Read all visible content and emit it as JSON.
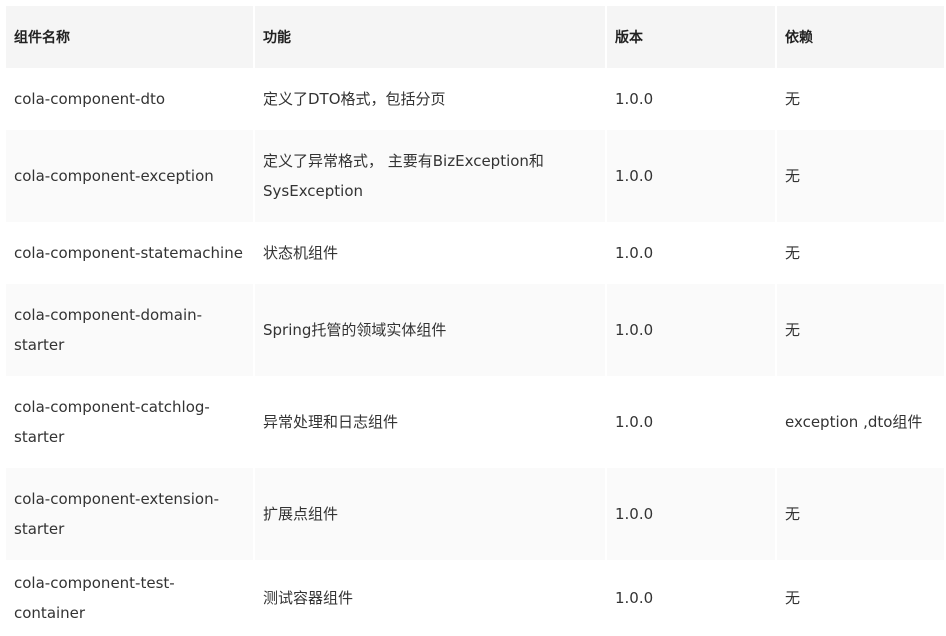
{
  "table": {
    "headers": [
      "组件名称",
      "功能",
      "版本",
      "依赖"
    ],
    "rows": [
      {
        "name": "cola-component-dto",
        "function": "定义了DTO格式，包括分页",
        "version": "1.0.0",
        "dependency": "无"
      },
      {
        "name": "cola-component-exception",
        "function": "定义了异常格式， 主要有BizException和SysException",
        "version": "1.0.0",
        "dependency": "无"
      },
      {
        "name": "cola-component-statemachine",
        "function": "状态机组件",
        "version": "1.0.0",
        "dependency": "无"
      },
      {
        "name": "cola-component-domain-starter",
        "function": "Spring托管的领域实体组件",
        "version": "1.0.0",
        "dependency": "无"
      },
      {
        "name": "cola-component-catchlog-starter",
        "function": "异常处理和日志组件",
        "version": "1.0.0",
        "dependency": "exception ,dto组件"
      },
      {
        "name": "cola-component-extension-starter",
        "function": "扩展点组件",
        "version": "1.0.0",
        "dependency": "无"
      },
      {
        "name": "cola-component-test-container",
        "function": "测试容器组件",
        "version": "1.0.0",
        "dependency": "无"
      }
    ]
  }
}
